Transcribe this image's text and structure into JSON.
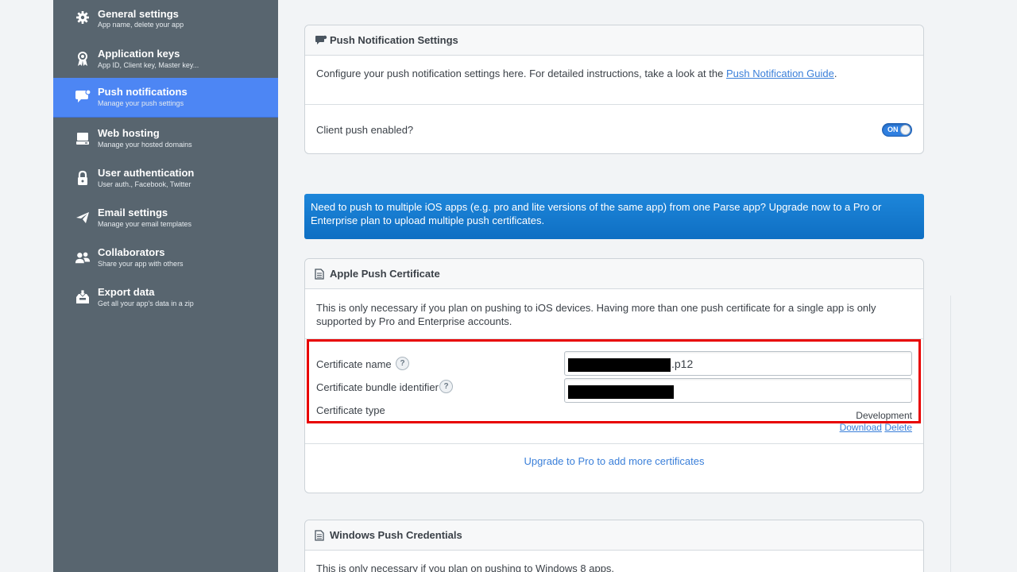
{
  "sidebar": {
    "items": [
      {
        "title": "General settings",
        "sub": "App name, delete your app",
        "icon": "gear-icon"
      },
      {
        "title": "Application keys",
        "sub": "App ID, Client key, Master key...",
        "icon": "key-ribbon-icon"
      },
      {
        "title": "Push notifications",
        "sub": "Manage your push settings",
        "icon": "chat-bubble-icon",
        "active": true
      },
      {
        "title": "Web hosting",
        "sub": "Manage your hosted domains",
        "icon": "server-icon"
      },
      {
        "title": "User authentication",
        "sub": "User auth., Facebook, Twitter",
        "icon": "lock-icon"
      },
      {
        "title": "Email settings",
        "sub": "Manage your email templates",
        "icon": "paper-plane-icon"
      },
      {
        "title": "Collaborators",
        "sub": "Share your app with others",
        "icon": "people-icon"
      },
      {
        "title": "Export data",
        "sub": "Get all your app's data in a zip",
        "icon": "inbox-download-icon"
      }
    ]
  },
  "push_settings": {
    "title": "Push Notification Settings",
    "description": "Configure your push notification settings here. For detailed instructions, take a look at the",
    "guide_link": "Push Notification Guide",
    "client_push_label": "Client push enabled?",
    "toggle_label": "ON"
  },
  "banner": {
    "text": "Need to push to multiple iOS apps (e.g. pro and lite versions of the same app) from one Parse app? Upgrade now to a Pro or Enterprise plan to upload multiple push certificates."
  },
  "apple_cert": {
    "title": "Apple Push Certificate",
    "description": "This is only necessary if you plan on pushing to iOS devices. Having more than one push certificate for a single app is only supported by Pro and Enterprise accounts.",
    "name_label": "Certificate name",
    "name_suffix": ".p12",
    "bundle_label": "Certificate bundle identifier",
    "type_label": "Certificate type",
    "type_value": "Development",
    "download_link": "Download",
    "delete_link": "Delete",
    "help_glyph": "?",
    "upgrade_link": "Upgrade to Pro to add more certificates"
  },
  "windows": {
    "title": "Windows Push Credentials",
    "description": "This is only necessary if you plan on pushing to Windows 8 apps."
  },
  "colors": {
    "sidebar": "#58656f",
    "active": "#4d86f4",
    "link": "#3a7fd9",
    "banner": "#1478cf",
    "highlight": "#e80000"
  }
}
